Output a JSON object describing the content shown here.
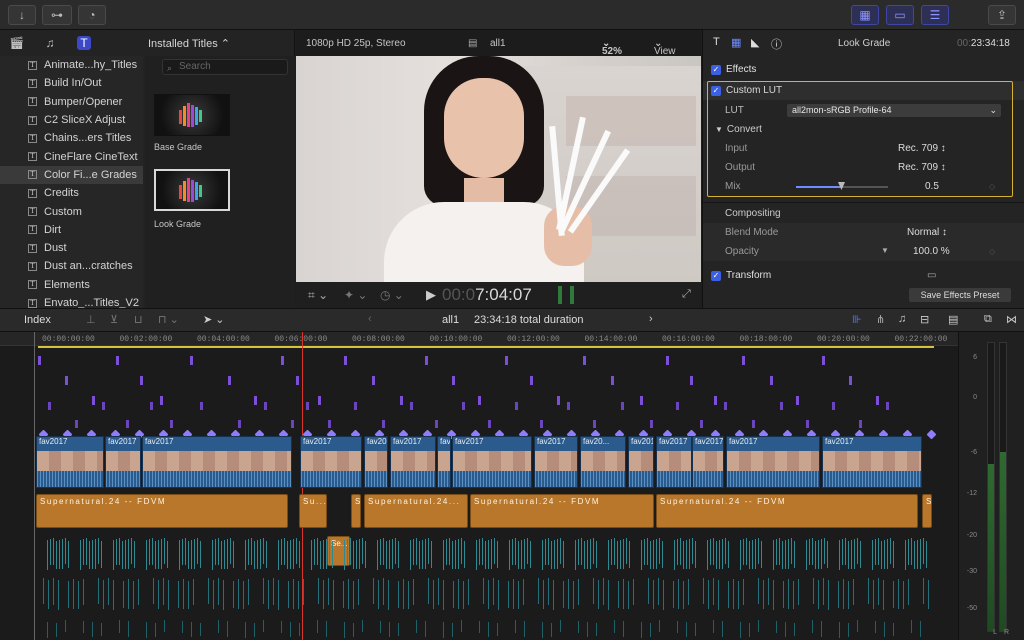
{
  "toolbar": {
    "import_icon": "import-arrow-icon",
    "keyword_icon": "key-icon",
    "bg_task_icon": "background-tasks-icon",
    "share_icon": "share-icon"
  },
  "browser": {
    "header": "Installed Titles",
    "search_placeholder": "Search",
    "categories": [
      "Animate...hy_Titles",
      "Build In/Out",
      "Bumper/Opener",
      "C2 SliceX Adjust",
      "Chains...ers Titles",
      "CineFlare CineText",
      "Color Fi...e Grades",
      "Credits",
      "Custom",
      "Dirt",
      "Dust",
      "Dust an...cratches",
      "Elements",
      "Envato_...Titles_V2"
    ],
    "selected_category": "Color Fi...e Grades",
    "items": [
      {
        "label": "Base Grade"
      },
      {
        "label": "Look Grade"
      }
    ]
  },
  "viewer": {
    "format": "1080p HD 25p, Stereo",
    "project": "all1",
    "zoom": "52%",
    "view_menu": "View",
    "timecode_dim": "00:0",
    "timecode": "7:04:07"
  },
  "inspector": {
    "title": "Look Grade",
    "duration_dim": "00:",
    "duration": "23:34:18",
    "effects_label": "Effects",
    "custom_lut_label": "Custom LUT",
    "lut_label": "LUT",
    "lut_value": "all2mon-sRGB Profile-64",
    "convert_label": "Convert",
    "input_label": "Input",
    "input_value": "Rec. 709 ↕",
    "output_label": "Output",
    "output_value": "Rec. 709 ↕",
    "mix_label": "Mix",
    "mix_value": "0.5",
    "mix_fraction": 0.5,
    "compositing_label": "Compositing",
    "blend_label": "Blend Mode",
    "blend_value": "Normal ↕",
    "opacity_label": "Opacity",
    "opacity_value": "100.0 %",
    "transform_label": "Transform",
    "save_preset": "Save Effects Preset"
  },
  "timeline_bar": {
    "index_label": "Index",
    "project": "all1",
    "duration_text": "23:34:18 total duration"
  },
  "timeline": {
    "ruler": [
      "00:00:00:00",
      "00:02:00:00",
      "00:04:00:00",
      "00:06:00:00",
      "00:08:00:00",
      "00:10:00:00",
      "00:12:00:00",
      "00:14:00:00",
      "00:16:00:00",
      "00:18:00:00",
      "00:20:00:00",
      "00:22:00:00"
    ],
    "video_clips": [
      "fav2017",
      "fav2017",
      "fav2017",
      "fav2017",
      "fav2017",
      "fav2017",
      "fav2017",
      "fav2017",
      "fav2017",
      "fav20...",
      "fav2017",
      "fav2017",
      "fav2017",
      "fav2017"
    ],
    "audio_clips": [
      "Supernatural.24 -- FDVM",
      "Su...",
      "S",
      "Supernatural.24...",
      "Supernatural.24 -- FDVM",
      "Supernatural.24 -- FDVM",
      "S"
    ],
    "sfx_clip": "Se..."
  },
  "meters": {
    "scale": [
      "6",
      "0",
      "-6",
      "-12",
      "-20",
      "-30",
      "-50"
    ],
    "channels": [
      "L",
      "R"
    ]
  },
  "colors": {
    "accent_blue": "#3b60e4",
    "highlight_gold": "#d8b233",
    "video_clip": "#2b5a8d",
    "audio_clip": "#b8772a",
    "playhead": "#d9352b"
  }
}
